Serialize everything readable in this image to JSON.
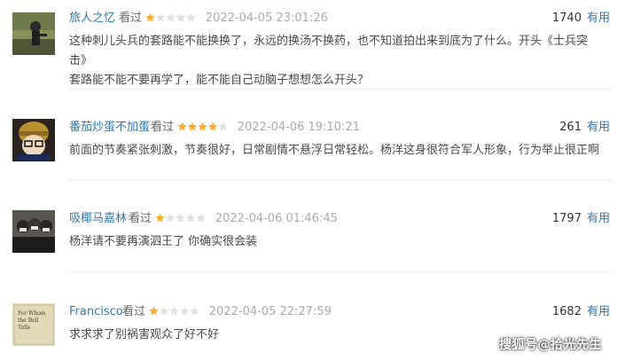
{
  "reviews": [
    {
      "username": "旅人之忆",
      "watched_label": "看过",
      "rating": 1,
      "rating_max": 5,
      "time": "2022-04-05 23:01:26",
      "votes": "1740",
      "useful_label": "有用",
      "content_line1": "这种刺儿头兵的套路能不能换换了，永远的换汤不换药，也不知道拍出来到底为了什么。开头《士兵突击》",
      "content_line2": "套路能不能不要再学了，能不能自己动脑子想想怎么开头？"
    },
    {
      "username": "番茄炒蛋不加蛋",
      "watched_label": "看过",
      "rating": 4,
      "rating_max": 5,
      "time": "2022-04-06 19:10:21",
      "votes": "261",
      "useful_label": "有用",
      "content_line1": "前面的节奏紧张刺激，节奏很好，日常剧情不悬浮日常轻松。杨洋这身很符合军人形象，行为举止很正啊",
      "content_line2": ""
    },
    {
      "username": "吸椰马嘉林",
      "watched_label": "看过",
      "rating": 1,
      "rating_max": 5,
      "time": "2022-04-06 01:46:45",
      "votes": "1797",
      "useful_label": "有用",
      "content_line1": "杨洋请不要再演泗王了 你确实很会装",
      "content_line2": ""
    },
    {
      "username": "Francisco",
      "watched_label": "看过",
      "rating": 1,
      "rating_max": 5,
      "time": "2022-04-05 22:27:59",
      "votes": "1682",
      "useful_label": "有用",
      "content_line1": "求求求了别祸害观众了好不好",
      "content_line2": "",
      "avatar_text": "For Whom the Bell Tolls"
    }
  ],
  "watermark": "搜狐号@拾光先生",
  "colors": {
    "link": "#3377aa",
    "star": "#ffac2d",
    "star_empty": "#e0e0e0",
    "time": "#aaaaaa",
    "content": "#494949"
  }
}
